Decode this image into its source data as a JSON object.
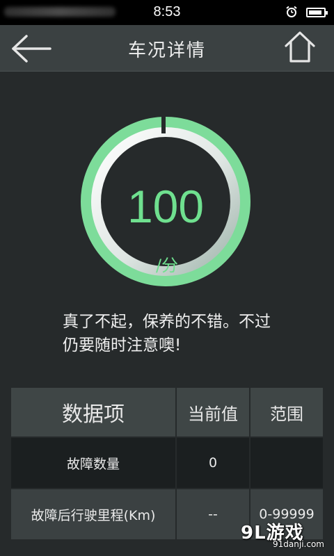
{
  "status_bar": {
    "time": "8:53",
    "icons": [
      "alarm-icon",
      "battery-icon"
    ]
  },
  "header": {
    "title": "车况详情",
    "left_icon": "back-arrow-icon",
    "right_icon": "home-icon"
  },
  "score": {
    "value": "100",
    "unit": "/分",
    "fraction": 1.0,
    "ring_color": "#6fe08f"
  },
  "message": "真了不起，保养的不错。不过仍要随时注意噢!",
  "table": {
    "headers": [
      "数据项",
      "当前值",
      "范围"
    ],
    "rows": [
      [
        "故障数量",
        "0",
        ""
      ],
      [
        "故障后行驶里程(Km)",
        "--",
        "0-99999"
      ]
    ]
  },
  "watermark": {
    "logo": "9L游戏",
    "site": "91danji.com"
  },
  "colors": {
    "background": "#262a2b",
    "header": "#3b4142",
    "accent": "#6fe08f"
  }
}
